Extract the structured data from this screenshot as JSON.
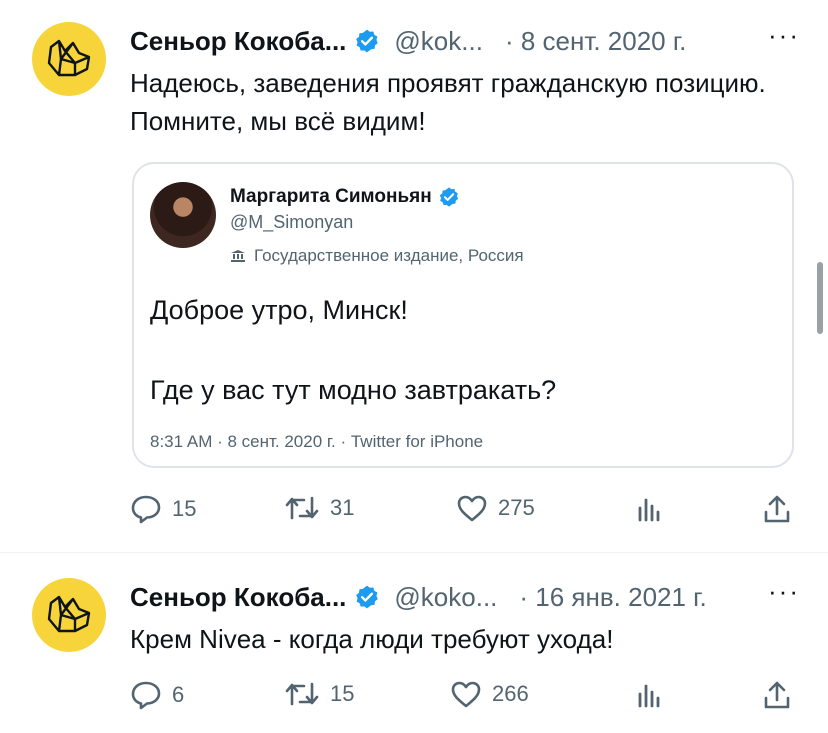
{
  "tweets": [
    {
      "author": "Сеньор Кокоба...",
      "handle": "@kok...",
      "date": "· 8 сент. 2020 г.",
      "text": "Надеюсь, заведения проявят гражданскую позицию. Помните, мы всё видим!",
      "quote": {
        "name": "Маргарита Симоньян",
        "handle": "@M_Simonyan",
        "label": "Государственное издание, Россия",
        "lines": [
          "Доброе утро, Минск!",
          "Где у вас тут модно завтракать?"
        ],
        "meta": "8:31 AM · 8 сент. 2020 г. · Twitter for iPhone"
      },
      "replies": "15",
      "retweets": "31",
      "likes": "275"
    },
    {
      "author": "Сеньор Кокоба...",
      "handle": "@koko...",
      "date": "· 16 янв. 2021 г.",
      "text": "Крем Nivea - когда люди требуют ухода!",
      "replies": "6",
      "retweets": "15",
      "likes": "266"
    }
  ],
  "more_label": "···",
  "colors": {
    "accent": "#1d9bf0",
    "avatar_bg": "#f7d53a",
    "muted": "#536471"
  }
}
